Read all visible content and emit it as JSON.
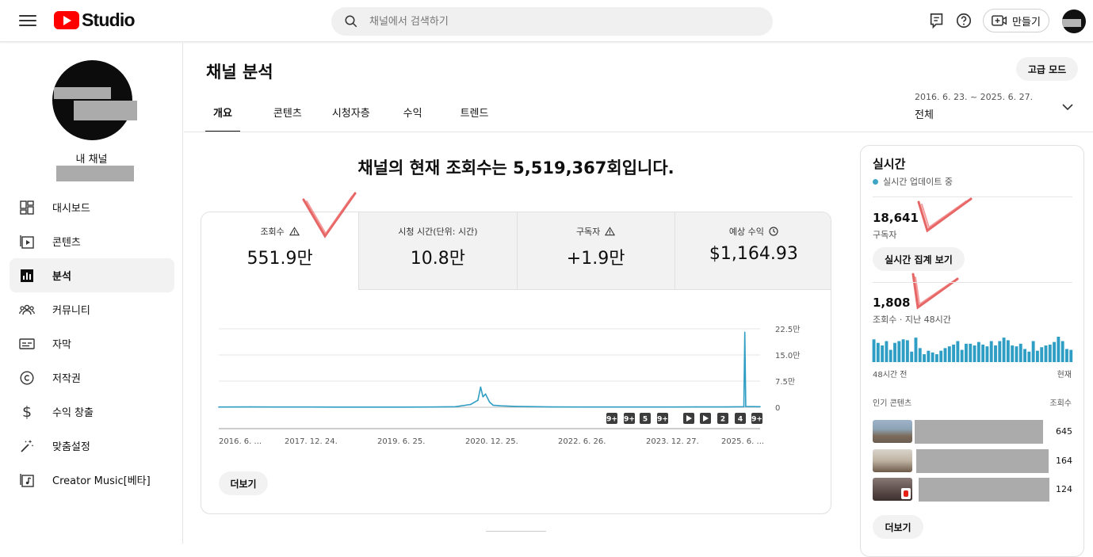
{
  "app": {
    "logo_text": "Studio",
    "brand_color": "#ff0000"
  },
  "search": {
    "placeholder": "채널에서 검색하기"
  },
  "topbar": {
    "create_label": "만들기"
  },
  "sidebar": {
    "channel_label": "내 채널",
    "items": [
      {
        "label": "대시보드",
        "icon": "dashboard-icon"
      },
      {
        "label": "콘텐츠",
        "icon": "content-icon"
      },
      {
        "label": "분석",
        "icon": "analytics-icon",
        "active": true
      },
      {
        "label": "커뮤니티",
        "icon": "community-icon"
      },
      {
        "label": "자막",
        "icon": "subtitles-icon"
      },
      {
        "label": "저작권",
        "icon": "copyright-icon"
      },
      {
        "label": "수익 창출",
        "icon": "dollar-icon"
      },
      {
        "label": "맞춤설정",
        "icon": "magic-wand-icon"
      },
      {
        "label": "Creator Music[베타]",
        "icon": "music-icon"
      }
    ]
  },
  "main": {
    "title": "채널 분석",
    "advanced_label": "고급 모드",
    "tabs": [
      "개요",
      "콘텐츠",
      "시청자층",
      "수익",
      "트렌드"
    ],
    "date_range": {
      "range": "2016. 6. 23. ~ 2025. 6. 27.",
      "label": "전체"
    },
    "headline": "채널의 현재 조회수는 5,519,367회입니다.",
    "metrics": [
      {
        "label": "조회수",
        "value": "551.9만",
        "icon": "warning-icon"
      },
      {
        "label": "시청 시간(단위: 시간)",
        "value": "10.8만"
      },
      {
        "label": "구독자",
        "value": "+1.9만",
        "icon": "warning-icon"
      },
      {
        "label": "예상 수익",
        "value": "$1,164.93",
        "icon": "clock-icon"
      }
    ],
    "more_label": "더보기"
  },
  "chart_data": {
    "type": "line",
    "x_ticks": [
      "2016. 6. ...",
      "2017. 12. 24.",
      "2019. 6. 25.",
      "2020. 12. 25.",
      "2022. 6. 26.",
      "2023. 12. 27.",
      "2025. 6. ..."
    ],
    "y_ticks": [
      "22.5만",
      "15.0만",
      "7.5만",
      "0"
    ],
    "ylim": [
      0,
      225000
    ],
    "series": [
      {
        "color": "#2f9ec4",
        "points": [
          [
            "2016-06-23",
            700
          ],
          [
            "2017-01-01",
            800
          ],
          [
            "2017-06-01",
            600
          ],
          [
            "2017-12-24",
            700
          ],
          [
            "2018-06-01",
            500
          ],
          [
            "2019-01-01",
            400
          ],
          [
            "2019-06-25",
            500
          ],
          [
            "2020-01-01",
            600
          ],
          [
            "2020-06-01",
            1500
          ],
          [
            "2020-09-01",
            8000
          ],
          [
            "2020-10-15",
            20000
          ],
          [
            "2020-11-01",
            58000
          ],
          [
            "2020-11-15",
            30000
          ],
          [
            "2020-12-01",
            38000
          ],
          [
            "2020-12-25",
            15000
          ],
          [
            "2021-01-15",
            6000
          ],
          [
            "2021-03-01",
            4000
          ],
          [
            "2021-06-01",
            2500
          ],
          [
            "2022-01-01",
            800
          ],
          [
            "2022-06-26",
            600
          ],
          [
            "2023-01-01",
            700
          ],
          [
            "2023-06-01",
            700
          ],
          [
            "2023-12-27",
            600
          ],
          [
            "2024-06-01",
            800
          ],
          [
            "2024-12-01",
            1000
          ],
          [
            "2025-03-20",
            1500
          ],
          [
            "2025-03-26",
            215000
          ],
          [
            "2025-04-01",
            2000
          ],
          [
            "2025-06-27",
            1500
          ]
        ]
      }
    ],
    "markers": [
      "9+",
      "9+",
      "5",
      "9+",
      "▶",
      "▶",
      "2",
      "4",
      "9+"
    ]
  },
  "realtime": {
    "title": "실시간",
    "status": "실시간 업데이트 중",
    "subscribers": "18,641",
    "subscribers_label": "구독자",
    "realtime_button": "실시간 집계 보기",
    "views": "1,808",
    "views_label": "조회수 · 지난 48시간",
    "bar_color": "#2f9ec4",
    "hourly_views": [
      26,
      22,
      19,
      24,
      14,
      22,
      24,
      26,
      25,
      12,
      28,
      16,
      9,
      13,
      11,
      9,
      13,
      16,
      18,
      20,
      24,
      14,
      21,
      21,
      19,
      23,
      20,
      18,
      24,
      19,
      24,
      28,
      25,
      19,
      18,
      21,
      15,
      12,
      24,
      13,
      17,
      19,
      20,
      23,
      29,
      24,
      15,
      14
    ],
    "axis_left": "48시간 전",
    "axis_right": "현재",
    "popular_header": "인기 콘텐츠",
    "views_header": "조회수",
    "popular": [
      {
        "views": "645"
      },
      {
        "views": "164"
      },
      {
        "views": "124"
      }
    ],
    "more_label": "더보기"
  }
}
